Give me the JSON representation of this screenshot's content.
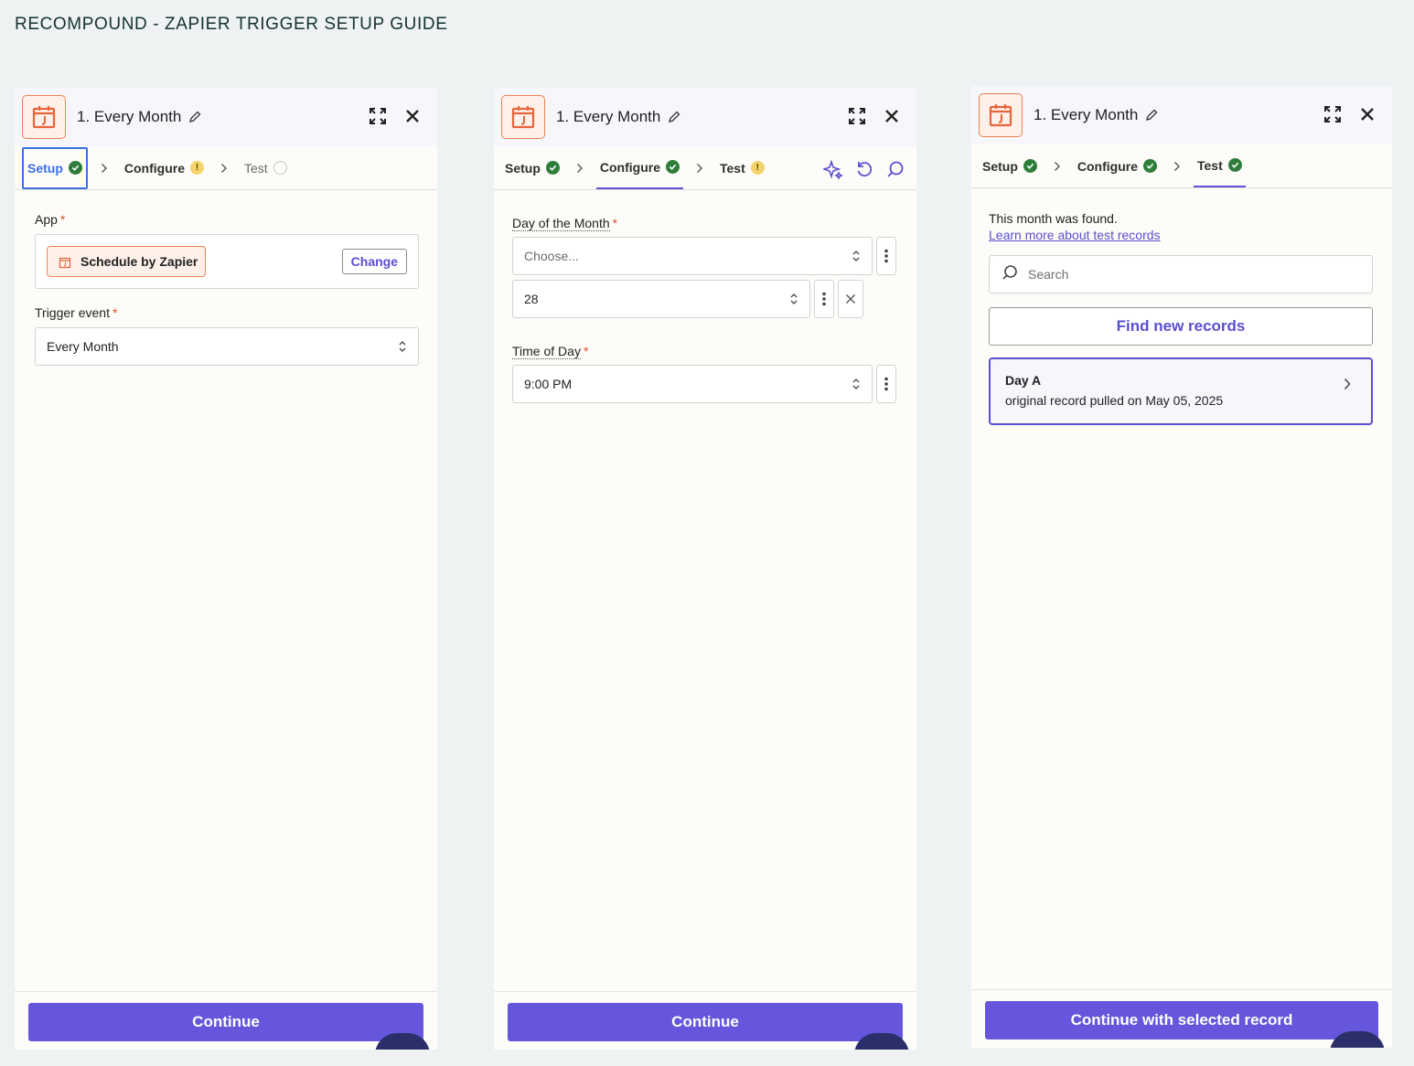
{
  "page_title": "RECOMPOUND - ZAPIER TRIGGER SETUP GUIDE",
  "colors": {
    "accent": "#6656dc",
    "success": "#2f7d3a",
    "warning": "#f4d36a",
    "app_orange": "#e8643a",
    "focus_blue": "#3b6fe0"
  },
  "panels": [
    {
      "title": "1. Every Month",
      "tabs": [
        {
          "label": "Setup",
          "status": "complete"
        },
        {
          "label": "Configure",
          "status": "warning"
        },
        {
          "label": "Test",
          "status": "pending"
        }
      ],
      "app_label": "App",
      "app_name": "Schedule by Zapier",
      "change_label": "Change",
      "trigger_label": "Trigger event",
      "trigger_value": "Every Month",
      "footer_button": "Continue"
    },
    {
      "title": "1. Every Month",
      "tabs": [
        {
          "label": "Setup",
          "status": "complete"
        },
        {
          "label": "Configure",
          "status": "complete"
        },
        {
          "label": "Test",
          "status": "warning"
        }
      ],
      "day_label": "Day of the Month",
      "day_placeholder": "Choose...",
      "day_value": "28",
      "time_label": "Time of Day",
      "time_value": "9:00 PM",
      "footer_button": "Continue"
    },
    {
      "title": "1. Every Month",
      "tabs": [
        {
          "label": "Setup",
          "status": "complete"
        },
        {
          "label": "Configure",
          "status": "complete"
        },
        {
          "label": "Test",
          "status": "complete"
        }
      ],
      "found_text": "This month was found.",
      "learn_link": "Learn more about test records",
      "search_placeholder": "Search",
      "find_button": "Find new records",
      "record_title": "Day A",
      "record_subtitle": "original record pulled on May 05, 2025",
      "footer_button": "Continue with selected record"
    }
  ]
}
